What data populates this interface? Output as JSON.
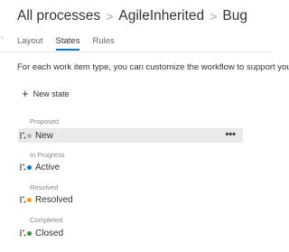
{
  "breadcrumb": {
    "root": "All processes",
    "process": "AgileInherited",
    "item": "Bug"
  },
  "tabs": [
    {
      "label": "Layout",
      "active": false
    },
    {
      "label": "States",
      "active": true
    },
    {
      "label": "Rules",
      "active": false
    }
  ],
  "description": "For each work item type, you can customize the workflow to support your t",
  "new_state_label": "New state",
  "icons": {
    "plus": "plus-icon",
    "drag": "drag-handle-icon",
    "more": "more-options-icon"
  },
  "categories": [
    {
      "label": "Proposed",
      "states": [
        {
          "name": "New",
          "color": "#b2b2b2",
          "selected": true
        }
      ]
    },
    {
      "label": "In Progress",
      "states": [
        {
          "name": "Active",
          "color": "#007acc",
          "selected": false
        }
      ]
    },
    {
      "label": "Resolved",
      "states": [
        {
          "name": "Resolved",
          "color": "#ff9d00",
          "selected": false
        }
      ]
    },
    {
      "label": "Completed",
      "states": [
        {
          "name": "Closed",
          "color": "#339933",
          "selected": false
        }
      ]
    }
  ],
  "more_glyph": "•••",
  "accent_color": "#0078d4"
}
